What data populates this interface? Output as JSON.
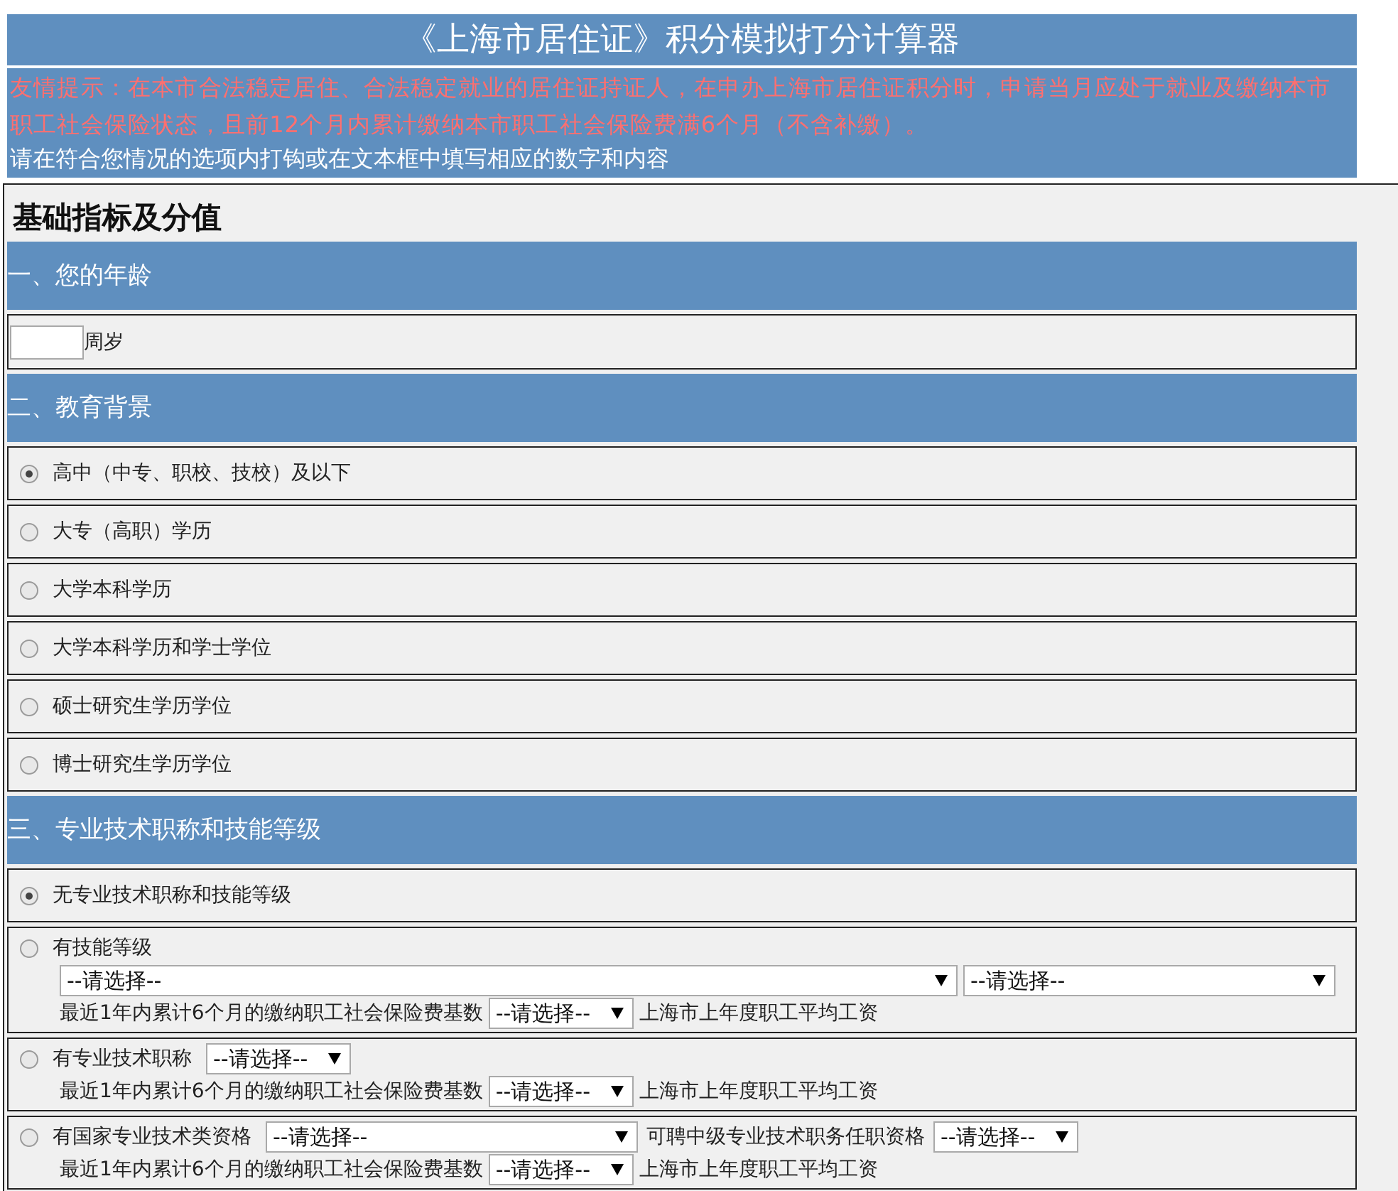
{
  "header": {
    "title": "《上海市居住证》积分模拟打分计算器",
    "notice": "友情提示：在本市合法稳定居住、合法稳定就业的居住证持证人，在申办上海市居住证积分时，申请当月应处于就业及缴纳本市职工社会保险状态，且前12个月内累计缴纳本市职工社会保险费满6个月（不含补缴）。",
    "instruction": "请在符合您情况的选项内打钩或在文本框中填写相应的数字和内容"
  },
  "main_heading": "基础指标及分值",
  "sections": [
    {
      "title": "一、您的年龄",
      "rows": [
        {
          "kind": "number",
          "suffix": "周岁"
        }
      ]
    },
    {
      "title": "二、教育背景",
      "rows": [
        {
          "kind": "radio",
          "label": "高中（中专、职校、技校）及以下",
          "selected": true
        },
        {
          "kind": "radio",
          "label": "大专（高职）学历",
          "selected": false
        },
        {
          "kind": "radio",
          "label": "大学本科学历",
          "selected": false
        },
        {
          "kind": "radio",
          "label": "大学本科学历和学士学位",
          "selected": false
        },
        {
          "kind": "radio",
          "label": "硕士研究生学历学位",
          "selected": false
        },
        {
          "kind": "radio",
          "label": "博士研究生学历学位",
          "selected": false
        }
      ]
    },
    {
      "title": "三、专业技术职称和技能等级",
      "rows": [
        {
          "kind": "radio",
          "label": "无专业技术职称和技能等级",
          "selected": true
        },
        {
          "kind": "radio",
          "label": "有技能等级",
          "selected": false,
          "lines": [
            [
              {
                "kind": "wide-select",
                "value": "--请选择--"
              },
              {
                "kind": "select",
                "value": "--请选择--"
              }
            ],
            [
              {
                "kind": "text",
                "text": "最近1年内累计6个月的缴纳职工社会保险费基数"
              },
              {
                "kind": "small-select",
                "value": "--请选择--"
              },
              {
                "kind": "text",
                "text": "上海市上年度职工平均工资"
              }
            ]
          ]
        },
        {
          "kind": "radio",
          "label": "有专业技术职称",
          "selected": false,
          "inline": [
            {
              "kind": "small-select",
              "value": "--请选择--"
            }
          ],
          "lines": [
            [
              {
                "kind": "text",
                "text": "最近1年内累计6个月的缴纳职工社会保险费基数"
              },
              {
                "kind": "small-select",
                "value": "--请选择--"
              },
              {
                "kind": "text",
                "text": "上海市上年度职工平均工资"
              }
            ]
          ]
        },
        {
          "kind": "radio",
          "label": "有国家专业技术类资格",
          "selected": false,
          "inline": [
            {
              "kind": "select",
              "value": "--请选择--"
            },
            {
              "kind": "text",
              "text": "可聘中级专业技术职务任职资格"
            },
            {
              "kind": "small-select",
              "value": "--请选择--"
            }
          ],
          "lines": [
            [
              {
                "kind": "text",
                "text": "最近1年内累计6个月的缴纳职工社会保险费基数"
              },
              {
                "kind": "small-select",
                "value": "--请选择--"
              },
              {
                "kind": "text",
                "text": "上海市上年度职工平均工资"
              }
            ]
          ]
        }
      ]
    }
  ]
}
